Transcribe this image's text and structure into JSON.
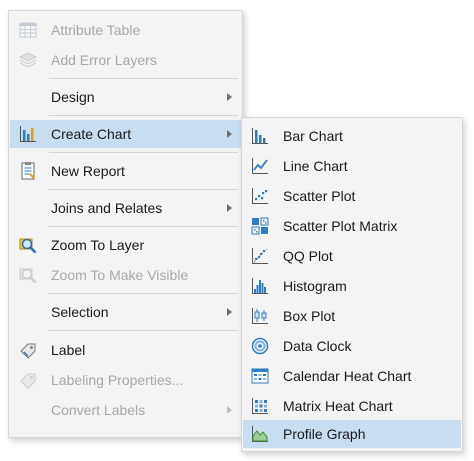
{
  "context_menu": {
    "items": [
      {
        "label": "Attribute Table",
        "icon": "table-icon",
        "enabled": false
      },
      {
        "label": "Add Error Layers",
        "icon": "error-layers-icon",
        "enabled": false
      },
      {
        "label": "Design",
        "icon": "",
        "enabled": true,
        "submenu": true
      },
      {
        "label": "Create Chart",
        "icon": "bar-chart-icon",
        "enabled": true,
        "submenu": true,
        "highlighted": true
      },
      {
        "label": "New Report",
        "icon": "report-icon",
        "enabled": true
      },
      {
        "label": "Joins and Relates",
        "icon": "",
        "enabled": true,
        "submenu": true
      },
      {
        "label": "Zoom To Layer",
        "icon": "zoom-to-layer-icon",
        "enabled": true
      },
      {
        "label": "Zoom To Make Visible",
        "icon": "zoom-visible-icon",
        "enabled": false
      },
      {
        "label": "Selection",
        "icon": "",
        "enabled": true,
        "submenu": true
      },
      {
        "label": "Label",
        "icon": "label-icon",
        "enabled": true
      },
      {
        "label": "Labeling Properties...",
        "icon": "labeling-properties-icon",
        "enabled": false
      },
      {
        "label": "Convert Labels",
        "icon": "",
        "enabled": false,
        "submenu": true
      }
    ]
  },
  "chart_submenu": {
    "items": [
      {
        "label": "Bar Chart",
        "icon": "bar-chart-icon"
      },
      {
        "label": "Line Chart",
        "icon": "line-chart-icon"
      },
      {
        "label": "Scatter Plot",
        "icon": "scatter-plot-icon"
      },
      {
        "label": "Scatter Plot Matrix",
        "icon": "scatter-matrix-icon"
      },
      {
        "label": "QQ Plot",
        "icon": "qq-plot-icon"
      },
      {
        "label": "Histogram",
        "icon": "histogram-icon"
      },
      {
        "label": "Box Plot",
        "icon": "box-plot-icon"
      },
      {
        "label": "Data Clock",
        "icon": "data-clock-icon"
      },
      {
        "label": "Calendar Heat Chart",
        "icon": "calendar-heat-icon"
      },
      {
        "label": "Matrix Heat Chart",
        "icon": "matrix-heat-icon"
      },
      {
        "label": "Profile Graph",
        "icon": "profile-graph-icon",
        "highlighted": true
      }
    ]
  },
  "colors": {
    "highlight": "#c9ddf0",
    "icon_blue": "#2f7ec1",
    "disabled_text": "#a7a7a7"
  }
}
